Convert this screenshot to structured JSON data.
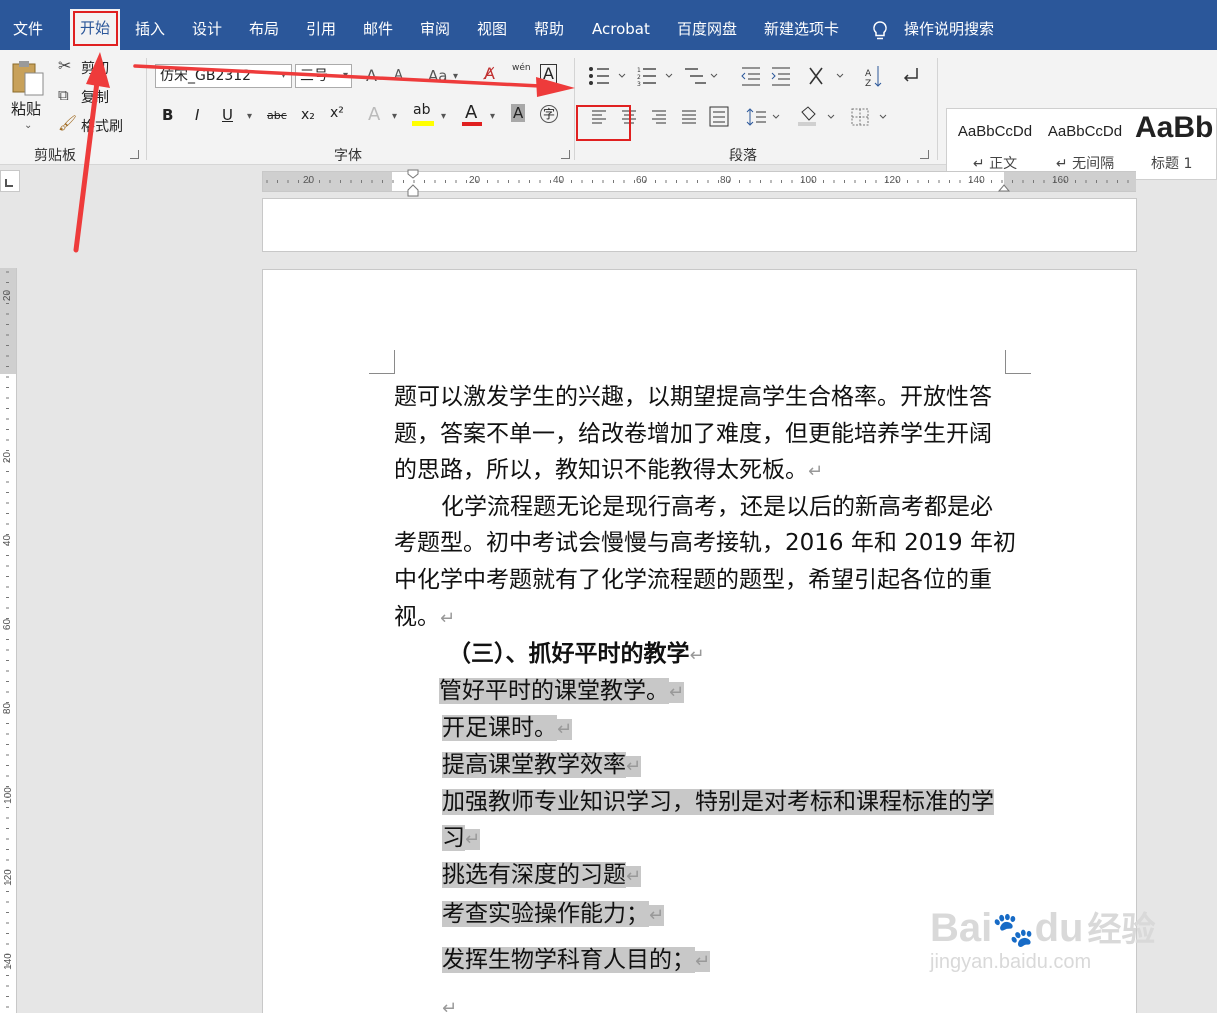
{
  "tabs": [
    {
      "label": "文件",
      "name": "tab-file"
    },
    {
      "label": "开始",
      "name": "tab-home"
    },
    {
      "label": "插入",
      "name": "tab-insert"
    },
    {
      "label": "设计",
      "name": "tab-design"
    },
    {
      "label": "布局",
      "name": "tab-layout"
    },
    {
      "label": "引用",
      "name": "tab-references"
    },
    {
      "label": "邮件",
      "name": "tab-mailings"
    },
    {
      "label": "审阅",
      "name": "tab-review"
    },
    {
      "label": "视图",
      "name": "tab-view"
    },
    {
      "label": "帮助",
      "name": "tab-help"
    },
    {
      "label": "Acrobat",
      "name": "tab-acrobat"
    },
    {
      "label": "百度网盘",
      "name": "tab-baidu-netdisk"
    },
    {
      "label": "新建选项卡",
      "name": "tab-new"
    }
  ],
  "search": {
    "label": "操作说明搜索",
    "icon": "lightbulb-icon"
  },
  "clipboard": {
    "group_label": "剪贴板",
    "paste": "粘贴",
    "cut": "剪切",
    "copy": "复制",
    "format_painter": "格式刷"
  },
  "font": {
    "group_label": "字体",
    "font_name": "仿宋_GB2312",
    "font_size": "三号",
    "grow": "A",
    "shrink": "A",
    "change_case": "Aa",
    "bold": "B",
    "italic": "I",
    "underline": "U",
    "strikethrough": "abc",
    "subscript": "x₂",
    "superscript": "x²",
    "text_effects": "A",
    "highlight": "ab",
    "font_color": "A",
    "char_shading": "A",
    "phonetic": "wén",
    "enclose": "字",
    "highlight_color": "#ffff00",
    "font_color_value": "#e02020"
  },
  "paragraph": {
    "group_label": "段落"
  },
  "styles": [
    {
      "sample": "AaBbCcDd",
      "name": "↵ 正文"
    },
    {
      "sample": "AaBbCcDd",
      "name": "↵ 无间隔"
    },
    {
      "sample": "AaBb",
      "name": "标题 1"
    }
  ],
  "ruler": {
    "h_numbers": [
      "20",
      "20",
      "40",
      "60",
      "80",
      "100",
      "120",
      "140",
      "160"
    ],
    "v_numbers": [
      "20",
      "20",
      "40",
      "60",
      "80",
      "100",
      "120",
      "140"
    ]
  },
  "document": {
    "lines": [
      {
        "text": "题可以激发学生的兴趣，以期望提高学生合格率。开放性答",
        "mark": ""
      },
      {
        "text": "题，答案不单一，给改卷增加了难度，但更能培养学生开阔",
        "mark": ""
      },
      {
        "text": "的思路，所以，教知识不能教得太死板。",
        "mark": "↵"
      },
      {
        "text": "化学流程题无论是现行高考，还是以后的新高考都是必",
        "mark": ""
      },
      {
        "text": "考题型。初中考试会慢慢与高考接轨，2016 年和 2019 年初",
        "mark": ""
      },
      {
        "text": "中化学中考题就有了化学流程题的题型，希望引起各位的重",
        "mark": ""
      },
      {
        "text": "视。",
        "mark": "↵"
      },
      {
        "text": "（三）、抓好平时的教学",
        "mark": "↵"
      },
      {
        "text": "管好平时的课堂教学。",
        "mark": "↵"
      },
      {
        "text": "开足课时。",
        "mark": "↵"
      },
      {
        "text": "提高课堂教学效率",
        "mark": "↵"
      },
      {
        "text": "加强教师专业知识学习，特别是对考标和课程标准的学",
        "mark": ""
      },
      {
        "text": "习",
        "mark": "↵"
      },
      {
        "text": "挑选有深度的习题",
        "mark": "↵"
      },
      {
        "text": "考查实验操作能力；",
        "mark": "↵"
      },
      {
        "text": "发挥生物学科育人目的；",
        "mark": "↵"
      },
      {
        "text": "",
        "mark": "↵"
      }
    ]
  },
  "watermark": {
    "brand": "Bai",
    "brand2": "du",
    "brand3": "经验",
    "url": "jingyan.baidu.com"
  },
  "colors": {
    "ribbon_blue": "#2b579a",
    "annotation_red": "#e02020",
    "selection": "#c8c8c8"
  }
}
